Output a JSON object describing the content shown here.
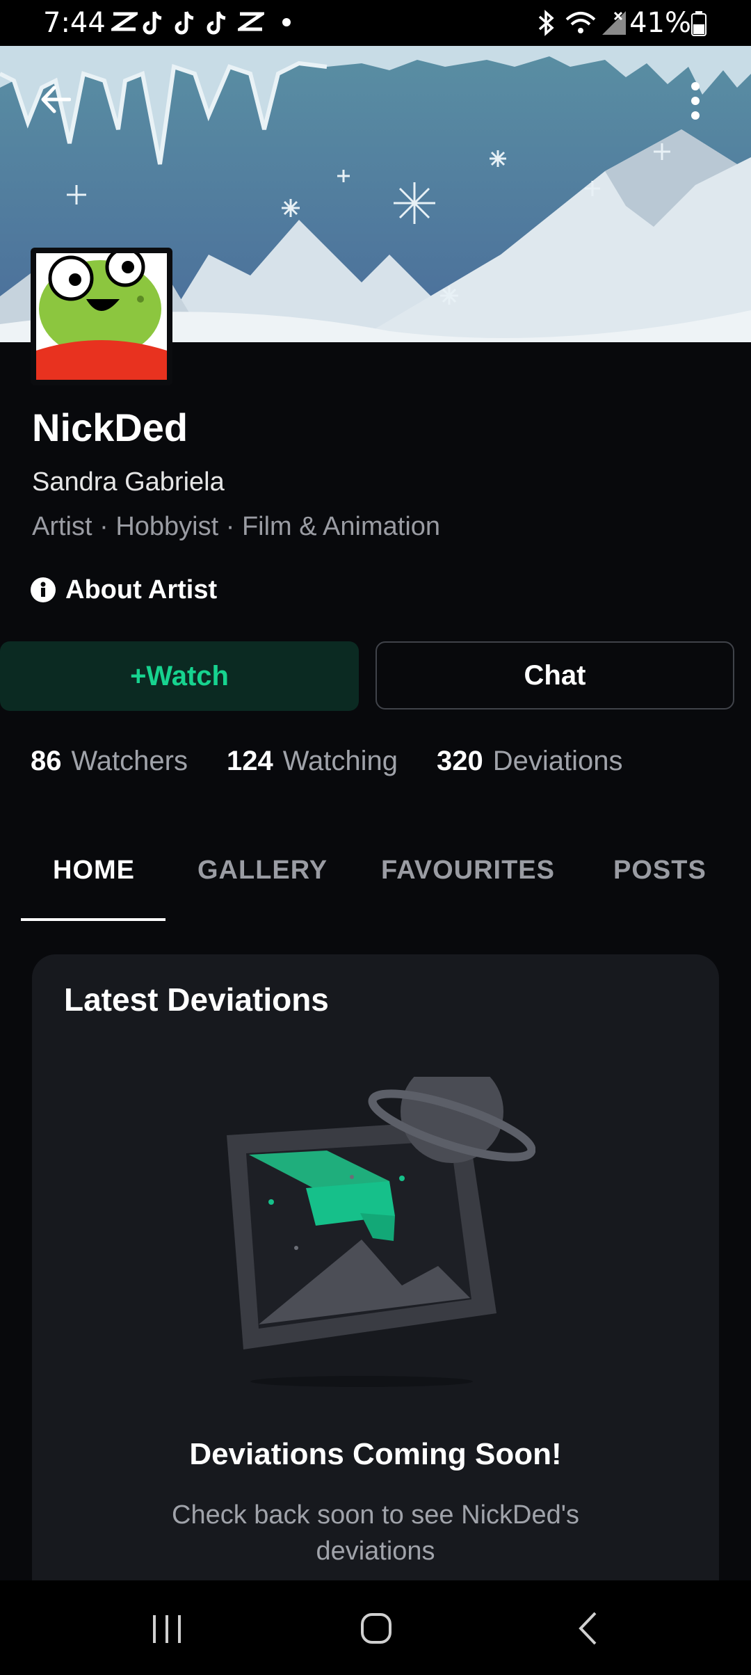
{
  "status_bar": {
    "time": "7:44",
    "battery": "41%",
    "notification_icons": [
      "capcut-icon",
      "tiktok-icon",
      "tiktok-icon",
      "tiktok-icon",
      "capcut-icon",
      "dot-icon"
    ],
    "system_icons": [
      "bluetooth-icon",
      "wifi-icon",
      "signal-icon",
      "battery-icon"
    ]
  },
  "header": {
    "back_icon": "arrow-left-icon",
    "menu_icon": "more-vertical-icon"
  },
  "profile": {
    "username": "NickDed",
    "real_name": "Sandra Gabriela",
    "roles": "Artist · Hobbyist · Film & Animation",
    "about_label": "About Artist"
  },
  "actions": {
    "watch_label": "+Watch",
    "chat_label": "Chat"
  },
  "stats": [
    {
      "value": "86",
      "label": "Watchers"
    },
    {
      "value": "124",
      "label": "Watching"
    },
    {
      "value": "320",
      "label": "Deviations"
    }
  ],
  "tabs": [
    {
      "label": "HOME",
      "active": true
    },
    {
      "label": "GALLERY",
      "active": false
    },
    {
      "label": "FAVOURITES",
      "active": false
    },
    {
      "label": "POSTS",
      "active": false
    }
  ],
  "latest": {
    "title": "Latest Deviations",
    "empty_title": "Deviations Coming Soon!",
    "empty_message": "Check back soon to see NickDed's deviations"
  },
  "colors": {
    "accent": "#17d38f",
    "background": "#08090c",
    "card": "#17191e"
  }
}
